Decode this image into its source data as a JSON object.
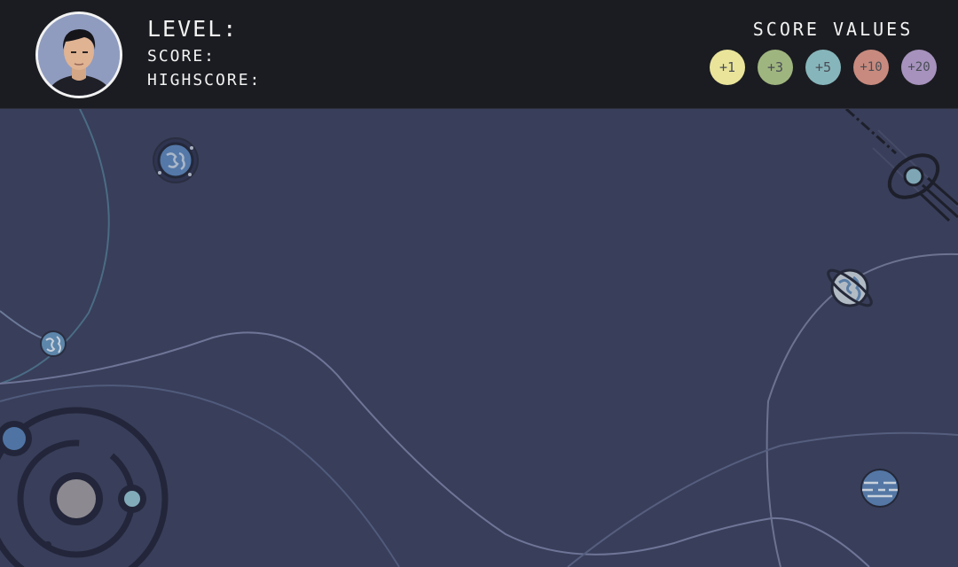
{
  "hud": {
    "level_label": "LEVEL:",
    "score_label": "SCORE:",
    "highscore_label": "HIGHSCORE:",
    "avatar_icon": "player-avatar-photo"
  },
  "score_values": {
    "title": "SCORE VALUES",
    "chips": [
      {
        "label": "+1",
        "color": "#e9e49a"
      },
      {
        "label": "+3",
        "color": "#9fb57f"
      },
      {
        "label": "+5",
        "color": "#86b6bb"
      },
      {
        "label": "+10",
        "color": "#c88a7e"
      },
      {
        "label": "+20",
        "color": "#a692bd"
      }
    ]
  },
  "board": {
    "background": "#393e5a",
    "icons": [
      "earth-planet-icon",
      "small-blue-planet-icon",
      "ringed-planet-icon",
      "striped-planet-icon",
      "comet-icon",
      "solar-system-icon"
    ]
  }
}
